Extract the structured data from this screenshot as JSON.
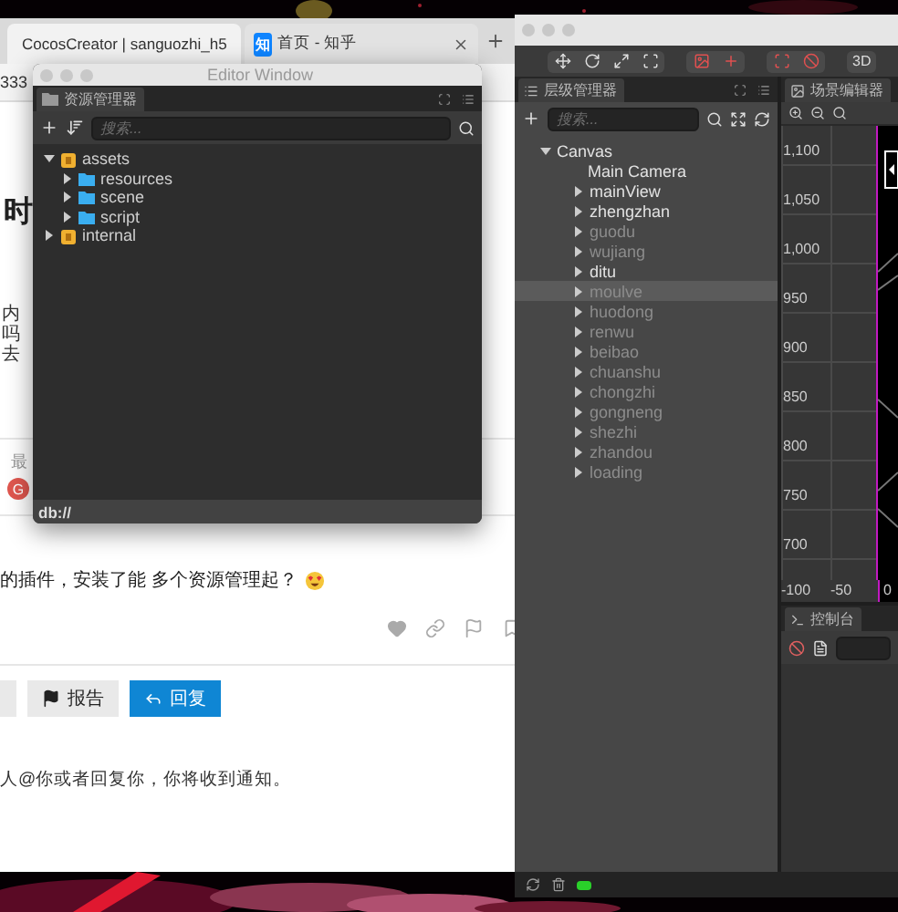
{
  "browser": {
    "tabs": [
      {
        "kind": "droplet",
        "title": "CocosCreator | sanguozhi_h5",
        "selected": true
      },
      {
        "kind": "badge",
        "badge": "知",
        "title": "首页 - 知乎",
        "selected": false
      }
    ],
    "address": "333",
    "heading": "时",
    "paragraph_lines": [
      "内",
      "吗",
      "去"
    ],
    "latest_label": "最",
    "avatar": "G",
    "post_text": "的插件，安装了能 多个资源管理起？",
    "buttons": [
      {
        "kind": "share"
      },
      {
        "kind": "flag",
        "label": "报告"
      },
      {
        "kind": "reply",
        "label": "回复"
      }
    ],
    "notice": "人@你或者回复你，你将收到通知。"
  },
  "asset_window": {
    "title": "Editor Window",
    "panel_tab": "资源管理器",
    "search_placeholder": "搜索...",
    "tree": [
      {
        "kind": "db",
        "name": "assets",
        "expanded": true,
        "children": [
          {
            "kind": "folder",
            "name": "resources",
            "expanded": false
          },
          {
            "kind": "folder",
            "name": "scene",
            "expanded": false
          },
          {
            "kind": "folder",
            "name": "script",
            "expanded": false
          }
        ]
      },
      {
        "kind": "db",
        "name": "internal",
        "expanded": false
      }
    ],
    "footer": "db://"
  },
  "creator": {
    "mode_button": "3D",
    "hierarchy": {
      "tab": "层级管理器",
      "search_placeholder": "搜索...",
      "tree": [
        {
          "name": "Canvas",
          "expandable": true,
          "expanded": true,
          "active": true,
          "selected": false,
          "children": [
            {
              "name": "Main Camera",
              "expandable": false,
              "active": true,
              "selected": false
            },
            {
              "name": "mainView",
              "expandable": true,
              "expanded": false,
              "active": true,
              "selected": false
            },
            {
              "name": "zhengzhan",
              "expandable": true,
              "expanded": false,
              "active": true,
              "selected": false
            },
            {
              "name": "guodu",
              "expandable": true,
              "expanded": false,
              "active": false,
              "selected": false
            },
            {
              "name": "wujiang",
              "expandable": true,
              "expanded": false,
              "active": false,
              "selected": false
            },
            {
              "name": "ditu",
              "expandable": true,
              "expanded": false,
              "active": true,
              "selected": false
            },
            {
              "name": "moulve",
              "expandable": true,
              "expanded": false,
              "active": false,
              "selected": true
            },
            {
              "name": "huodong",
              "expandable": true,
              "expanded": false,
              "active": false,
              "selected": false
            },
            {
              "name": "renwu",
              "expandable": true,
              "expanded": false,
              "active": false,
              "selected": false
            },
            {
              "name": "beibao",
              "expandable": true,
              "expanded": false,
              "active": false,
              "selected": false
            },
            {
              "name": "chuanshu",
              "expandable": true,
              "expanded": false,
              "active": false,
              "selected": false
            },
            {
              "name": "chongzhi",
              "expandable": true,
              "expanded": false,
              "active": false,
              "selected": false
            },
            {
              "name": "gongneng",
              "expandable": true,
              "expanded": false,
              "active": false,
              "selected": false
            },
            {
              "name": "shezhi",
              "expandable": true,
              "expanded": false,
              "active": false,
              "selected": false
            },
            {
              "name": "zhandou",
              "expandable": true,
              "expanded": false,
              "active": false,
              "selected": false
            },
            {
              "name": "loading",
              "expandable": true,
              "expanded": false,
              "active": false,
              "selected": false
            }
          ]
        }
      ]
    },
    "scene": {
      "tab": "场景编辑器",
      "y_ticks": [
        "1,100",
        "1,050",
        "1,000",
        "950",
        "900",
        "850",
        "800",
        "750",
        "700"
      ],
      "x_ticks": [
        "-100",
        "-50",
        "0"
      ]
    },
    "console": {
      "tab": "控制台"
    }
  }
}
